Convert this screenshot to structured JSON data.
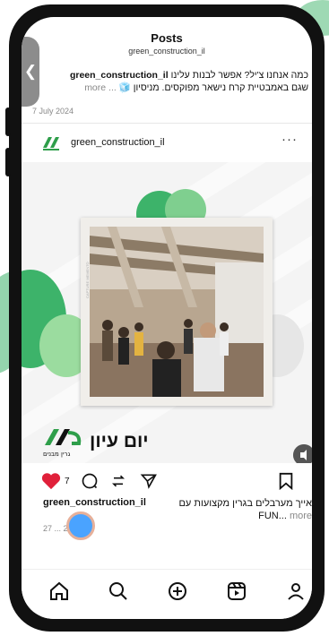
{
  "header": {
    "title": "Posts",
    "subtitle": "green_construction_il"
  },
  "previous_post": {
    "caption_text": "כמה אנחנו צ'יל? אפשר לבנות עלינו",
    "caption_user": "green_construction_il",
    "caption_line2": "שגם באמבטיית קרח נישאר מפוקסים. מניסיון",
    "emoji": "🧊",
    "more_label": "... more",
    "date": "7 July 2024"
  },
  "post": {
    "username": "green_construction_il",
    "menu_label": "···",
    "image_caption_hebrew": "יום עיון",
    "brand_logo_text": "גרין מבנים",
    "like_count": "7",
    "caption_user": "green_construction_il",
    "caption_text": "אייך מערבלים בגרין מקצועות עם FUN...",
    "more_label": "more",
    "date": "27 ... 2024"
  },
  "nav": {
    "items": [
      "home-icon",
      "search-icon",
      "create-icon",
      "reels-icon",
      "profile-icon"
    ]
  },
  "colors": {
    "brand_green": "#2e9e4a",
    "like_red": "#e0203a",
    "accent_leaf": "#3db36a"
  }
}
